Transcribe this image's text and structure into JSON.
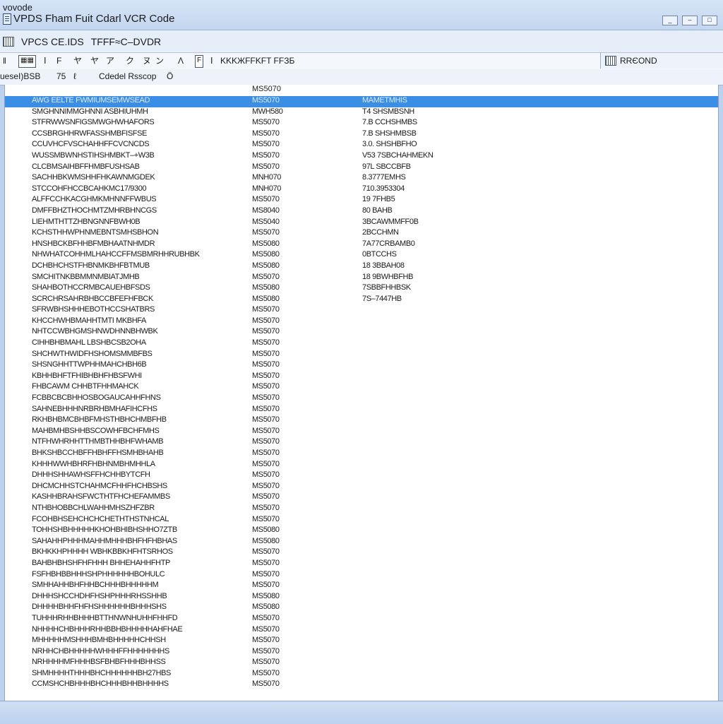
{
  "window": {
    "app_label": "vovode",
    "title": "VPDS Fham Fuit Cdarl VCR Code",
    "controls": [
      "_",
      "–",
      "□"
    ]
  },
  "menubar": {
    "items": [
      "VPCS CE.IDS",
      "TFFF≈C–DVDR"
    ]
  },
  "toolbar": {
    "items": [
      "‖",
      "▦▦",
      "Ⅰ",
      "F",
      "ヤ",
      "ヤ",
      "ア",
      "ク",
      "ヌ",
      "ン",
      "Λ",
      "F",
      "Ⅰ",
      "KKKЖFFKFT FFЗБ"
    ],
    "right_label": "RRЄOND"
  },
  "subbar": {
    "items": [
      "ueseI)BSB",
      "75",
      "ℓ",
      "Cdedel Rsscop",
      "Ö"
    ]
  },
  "list": {
    "header_col2": "MS5070",
    "rows": [
      {
        "c1": "AWG EELTE FWMIUMSEMWSEAD",
        "c2": "MS5070",
        "c3": "MAMETMHIS",
        "sel": true
      },
      {
        "c1": "SMGHNNIMMGHNNI ASBHIUHMH",
        "c2": "MWH580",
        "c3": "T4 SHSMBSNH"
      },
      {
        "c1": "STFRWWSNFIGSMWGHWHAFORS",
        "c2": "MS5070",
        "c3": "7.B CCHSHMBS"
      },
      {
        "c1": "CCSBRGHHRWFASSHMBFISFSE",
        "c2": "MS5070",
        "c3": "7.B SHSHMBSB"
      },
      {
        "c1": "CCUVHCFVSCHAHHFFCVCNCDS",
        "c2": "MS5070",
        "c3": "3.0. SHSHBFHO"
      },
      {
        "c1": "WUSSMBWNHSTIHSHMBKT–+W3B",
        "c2": "MS5070",
        "c3": "V53 7SBCHAHMEKN"
      },
      {
        "c1": "CLCBMSAIHBFFHMBFUSHSAB",
        "c2": "MS5070",
        "c3": "97L SBCCBFB"
      },
      {
        "c1": "SACHHBKWMSHHFHKAWNMGDEK",
        "c2": "MNH070",
        "c3": "8.3777EMHS"
      },
      {
        "c1": "STCCOHFHCCBCAHKMC17/9300",
        "c2": "MNH070",
        "c3": "710.3953304"
      },
      {
        "c1": "ALFFCCHKACGHMKMHNNFFWBUS",
        "c2": "MS5070",
        "c3": "19 7FHB5"
      },
      {
        "c1": "DMFFBHZTHOCHMTZMHRBHNCGS",
        "c2": "MS8040",
        "c3": "80 BAHB"
      },
      {
        "c1": "LIEHMTHTTZHBNGNNFBWH0B",
        "c2": "MS5040",
        "c3": "3BCAWMMFF0B"
      },
      {
        "c1": "KCHSTHHWPHNMEBNTSMHSBHON",
        "c2": "MS5070",
        "c3": "2BCCHMN"
      },
      {
        "c1": "HNSHBCKBFHHBFMBHAATNHMDR",
        "c2": "MS5080",
        "c3": "7A77CRBAMB0"
      },
      {
        "c1": "NHWHATCOHHMLHAHCCFFMSBMRHHRUBHBK",
        "c2": "MS5080",
        "c3": "0BTCCHS"
      },
      {
        "c1": "DCHBHCHSTFHBNMKBHFBTMUB",
        "c2": "MS5080",
        "c3": "18 3BBAH08"
      },
      {
        "c1": "SMCHITNKBBMMNMBIATJMHB",
        "c2": "MS5070",
        "c3": "18 9BWHBFHB"
      },
      {
        "c1": "SHAHBOTHCCRMBCAUEHBFSDS",
        "c2": "MS5080",
        "c3": "7SBBFHHBSK"
      },
      {
        "c1": "SCRCHRSAHRBHBCCBFEFHFBCK",
        "c2": "MS5080",
        "c3": "7S–7447HB"
      },
      {
        "c1": "SFRWBHSHHHEBOTHCCSHATBRS",
        "c2": "MS5070",
        "c3": ""
      },
      {
        "c1": "KHCCHWHBMAHHTMTI MKBHFA",
        "c2": "MS5070",
        "c3": ""
      },
      {
        "c1": "NHTCCWBHGMSHNWDHNNBHWBK",
        "c2": "MS5070",
        "c3": ""
      },
      {
        "c1": "CIHHBHBMAHL LBSHBCSB2OHA",
        "c2": "MS5070",
        "c3": ""
      },
      {
        "c1": "SHCHWTHWIDFHSHOMSMMBFBS",
        "c2": "MS5070",
        "c3": ""
      },
      {
        "c1": "SHSNGHHTTWPHHMAHCHBH6B",
        "c2": "MS5070",
        "c3": ""
      },
      {
        "c1": "KBHHBHFTFHIBHBHFHBSFWHI",
        "c2": "MS5070",
        "c3": ""
      },
      {
        "c1": "FHBCAWM CHHBTFHHMAHCK",
        "c2": "MS5070",
        "c3": ""
      },
      {
        "c1": "FCBBCBCBHHOSBOGAUCAHHFHNS",
        "c2": "MS5070",
        "c3": ""
      },
      {
        "c1": "SAHNEBHHHNRBRHBMHAFIHCFHS",
        "c2": "MS5070",
        "c3": ""
      },
      {
        "c1": "RKHBHBMCBHBFMHSTHBHCHMBFHB",
        "c2": "MS5070",
        "c3": ""
      },
      {
        "c1": "MAHBMHBSHHBSCOWHFBCHFMHS",
        "c2": "MS5070",
        "c3": ""
      },
      {
        "c1": "NTFHWHRHHTTHMBTHHBHFWHAMB",
        "c2": "MS5070",
        "c3": ""
      },
      {
        "c1": "BHKSHBCCHBFFHBHFFHSMHBHAHB",
        "c2": "MS5070",
        "c3": ""
      },
      {
        "c1": "KHHHWWHBHRFHBHNMBHMHHLA",
        "c2": "MS5070",
        "c3": ""
      },
      {
        "c1": "DHHHSHHAWHSFFHCHHBYTCFH",
        "c2": "MS5070",
        "c3": ""
      },
      {
        "c1": "DHCMCHHSTCHAHMCFHHFHCHBSHS",
        "c2": "MS5070",
        "c3": ""
      },
      {
        "c1": "KASHHBRAHSFWCTHTFHCHEFAMMBS",
        "c2": "MS5070",
        "c3": ""
      },
      {
        "c1": "NTHBHOBBCHLWAHHMHSZHFZBR",
        "c2": "MS5070",
        "c3": ""
      },
      {
        "c1": "FCOHBHSEHCHCHCHETHTHSTNHCAL",
        "c2": "MS5070",
        "c3": ""
      },
      {
        "c1": "TOHHSHBHHHHHKHOHBHIBHSHHO7ZTB",
        "c2": "MS5080",
        "c3": ""
      },
      {
        "c1": "SAHAHHPHHHMAHHMHHHBHFHFHBHAS",
        "c2": "MS5080",
        "c3": ""
      },
      {
        "c1": "BKHKKHPHHHH WBHKBBKHFHTSRHOS",
        "c2": "MS5070",
        "c3": ""
      },
      {
        "c1": "BAHBHBHSHFHFHHH BHHEHAHHFHTP",
        "c2": "MS5070",
        "c3": ""
      },
      {
        "c1": "FSFHBHBBHHHSHPHHHHHHBOHULC",
        "c2": "MS5070",
        "c3": ""
      },
      {
        "c1": "SMHHAHHBHFHHBCHHHBHHHHHM",
        "c2": "MS5070",
        "c3": ""
      },
      {
        "c1": "DHHHSHCCHDHFHSHPHHHRHSSHHB",
        "c2": "MS5080",
        "c3": ""
      },
      {
        "c1": "DHHHHBHHFHFHSHHHHHHBHHHSHS",
        "c2": "MS5080",
        "c3": ""
      },
      {
        "c1": "TUHHHRHHBHHHBTTHNWNHUHHFHHFD",
        "c2": "MS5070",
        "c3": ""
      },
      {
        "c1": "NHHHHCHBHHHRHHBBHBHHHHHAHFHAE",
        "c2": "MS5070",
        "c3": ""
      },
      {
        "c1": "MHHHHHMSHHHBMHBHHHHHCHHSH",
        "c2": "MS5070",
        "c3": ""
      },
      {
        "c1": "NRHHCHBHHHHHWHHHFFHHHHHHHS",
        "c2": "MS5070",
        "c3": ""
      },
      {
        "c1": "NRHHHHMFHHHBSFBHBFHHHBHHSS",
        "c2": "MS5070",
        "c3": ""
      },
      {
        "c1": "SHMHHHHTHHHBHCHHHHHHBH27HBS",
        "c2": "MS5070",
        "c3": ""
      },
      {
        "c1": "CCMSHCHBHHHBHCHHHBHHBHHHHS",
        "c2": "MS5070",
        "c3": ""
      }
    ]
  }
}
